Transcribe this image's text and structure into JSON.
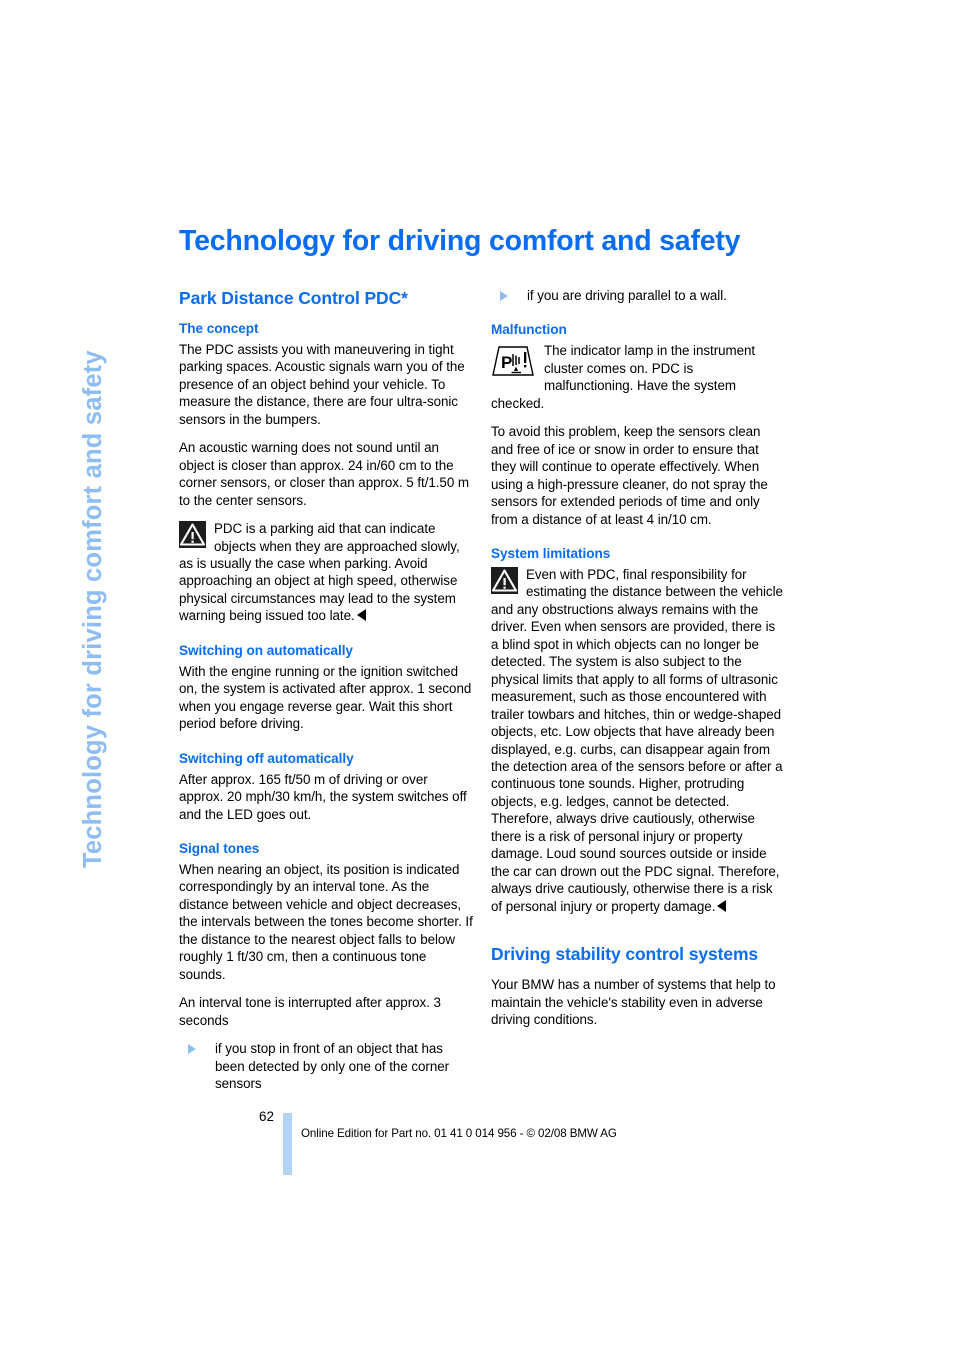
{
  "document": {
    "side_tab_text": "Technology for driving comfort and safety",
    "chapter_title": "Technology for driving comfort and safety",
    "page_number": "62",
    "footer_note": "Online Edition for Part no. 01 41 0 014 956 - © 02/08 BMW AG",
    "colors": {
      "heading_blue": "#0a6df0",
      "side_tab_blue": "#8fbdf2",
      "footer_bar_blue": "#b4d4f7",
      "body_black": "#000000"
    }
  },
  "left_column": {
    "section_heading": "Park Distance Control PDC*",
    "sub_concept": {
      "heading": "The concept",
      "paragraph_1": "The PDC assists you with maneuvering in tight parking spaces. Acoustic signals warn you of the presence of an object behind your vehicle. To measure the distance, there are four ultra-sonic sensors in the bumpers.",
      "paragraph_2": "An acoustic warning does not sound until an object is closer than approx. 24 in/60 cm to the corner sensors, or closer than approx. 5 ft/1.50 m to the center sensors."
    },
    "warning_1": {
      "icon": "warning-triangle-icon",
      "text": "PDC is a parking aid that can indicate objects when they are approached slowly, as is usually the case when parking. Avoid approaching an object at high speed, otherwise physical circumstances may lead to the system warning being issued too late."
    },
    "sub_switch_on": {
      "heading": "Switching on automatically",
      "paragraph": "With the engine running or the ignition switched on, the system is activated after approx. 1 second when you engage reverse gear. Wait this short period before driving."
    },
    "sub_switch_off": {
      "heading": "Switching off automatically",
      "paragraph": "After approx. 165 ft/50 m of driving or over approx. 20 mph/30 km/h, the system switches off and the LED goes out."
    },
    "sub_signal_tones": {
      "heading": "Signal tones",
      "paragraph_1": "When nearing an object, its position is indicated correspondingly by an interval tone. As the distance between vehicle and object decreases, the intervals between the tones become shorter. If the distance to the nearest object falls to below roughly 1 ft/30 cm, then a continuous tone sounds.",
      "paragraph_2": "An interval tone is interrupted after approx. 3 seconds",
      "bullet_1": "if you stop in front of an object that has been detected by only one of the corner sensors"
    }
  },
  "right_column": {
    "bullet_1": "if you are driving parallel to a wall.",
    "sub_malfunction": {
      "heading": "Malfunction",
      "icon": "pdc-indicator-lamp-icon",
      "icon_text": "The indicator lamp in the instrument cluster comes on. PDC is malfunctioning. Have the system checked.",
      "paragraph": "To avoid this problem, keep the sensors clean and free of ice or snow in order to ensure that they will continue to operate effectively. When using a high-pressure cleaner, do not spray the sensors for extended periods of time and only from a distance of at least 4 in/10 cm."
    },
    "sub_system_limitations": {
      "heading": "System limitations",
      "warning_icon": "warning-triangle-icon",
      "warning_text": "Even with PDC, final responsibility for estimating the distance between the vehicle and any obstructions always remains with the driver. Even when sensors are provided, there is a blind spot in which objects can no longer be detected. The system is also subject to the physical limits that apply to all forms of ultrasonic measurement, such as those encountered with trailer towbars and hitches, thin or wedge-shaped objects, etc. Low objects that have already been displayed, e.g. curbs, can disappear again from the detection area of the sensors before or after a continuous tone sounds. Higher, protruding objects, e.g. ledges, cannot be detected. Therefore, always drive cautiously, otherwise there is a risk of personal injury or property damage. Loud sound sources outside or inside the car can drown out the PDC signal. Therefore, always drive cautiously, otherwise there is a risk of personal injury or property damage."
    },
    "section_driving_stability": {
      "heading": "Driving stability control systems",
      "paragraph": "Your BMW has a number of systems that help to maintain the vehicle's stability even in adverse driving conditions."
    }
  }
}
